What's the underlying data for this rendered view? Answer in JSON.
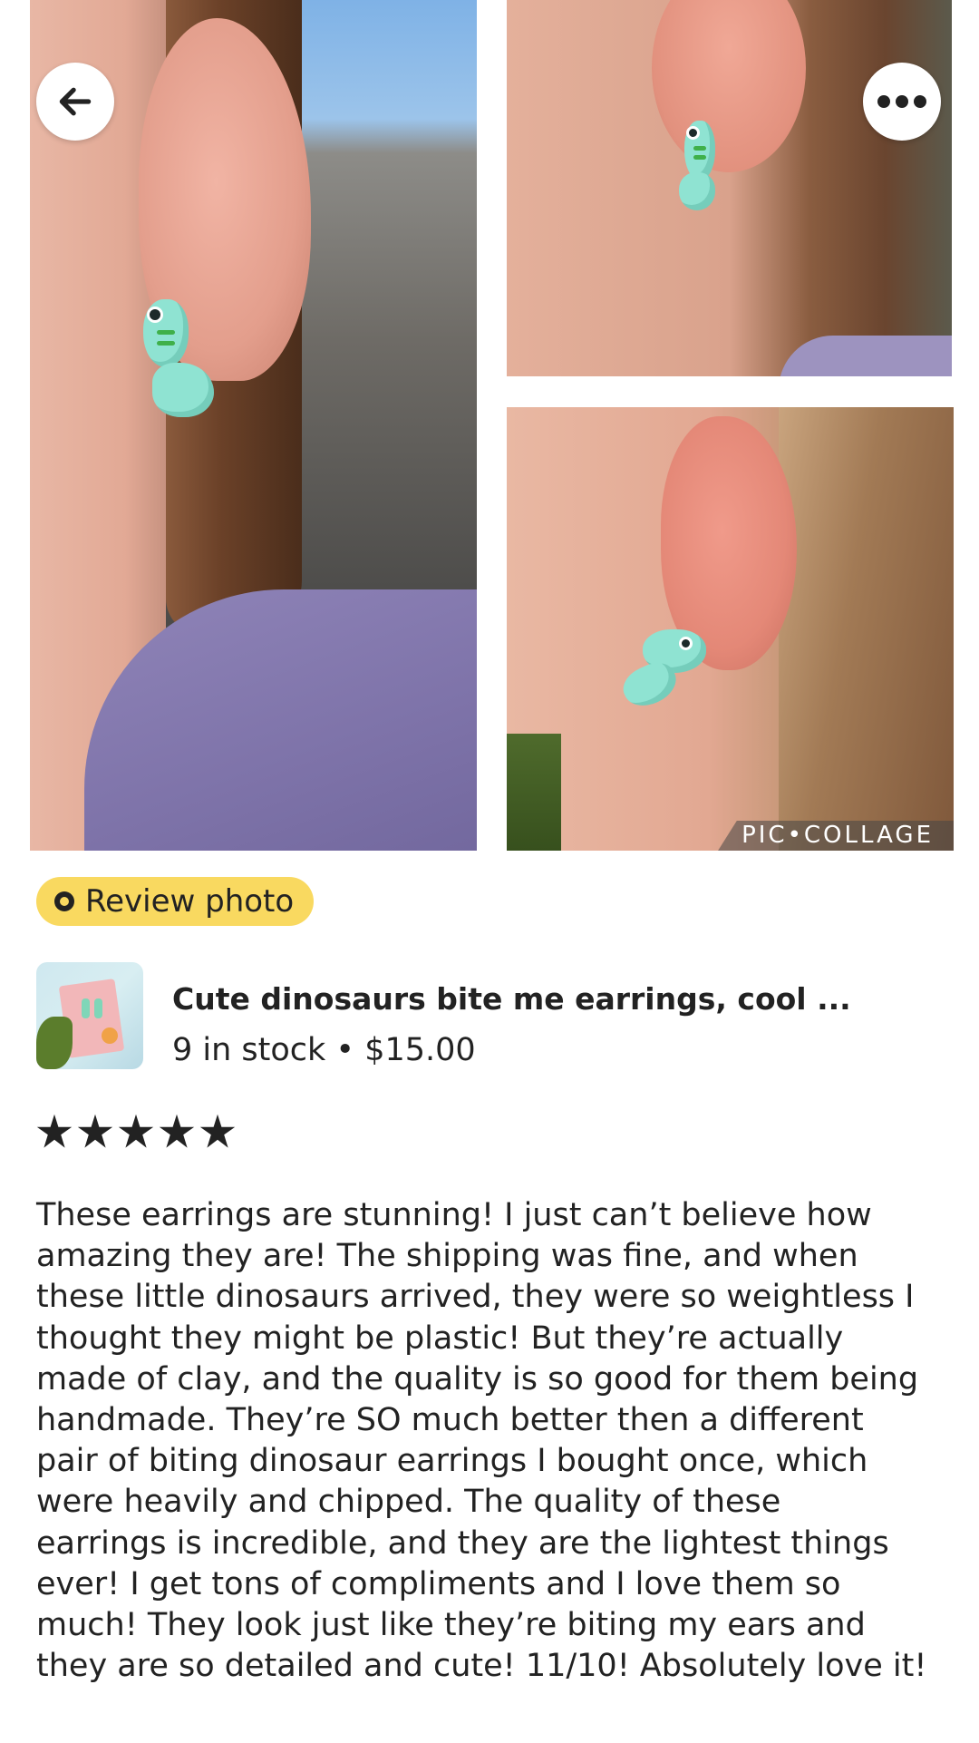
{
  "photos": {
    "watermark": "PIC•COLLAGE"
  },
  "header": {
    "back_icon": "arrow-left-icon",
    "more_icon": "more-horizontal-icon"
  },
  "badge": {
    "label": "Review photo",
    "color": "#f9d960"
  },
  "product": {
    "title": "Cute dinosaurs bite me earrings, cool ...",
    "meta": "9 in stock • $15.00"
  },
  "rating": {
    "stars": 5,
    "max": 5
  },
  "review": {
    "lines": [
      "These earrings are stunning! I just can’t believe how",
      "amazing they are! The shipping was fine, and when",
      "these little dinosaurs arrived, they were so weightless I",
      "thought they might be plastic! But they’re actually",
      "made of clay, and the quality is so good for them being",
      "handmade. They’re SO much better then a different",
      "pair of biting dinosaur earrings I bought once, which",
      "were heavily and chipped. The quality of these",
      "earrings is incredible, and they are the lightest things",
      "ever! I get tons of compliments and I love them so",
      "much! They look just like they’re biting my ears and",
      "they are so detailed and cute! 11/10! Absolutely love it!"
    ]
  }
}
